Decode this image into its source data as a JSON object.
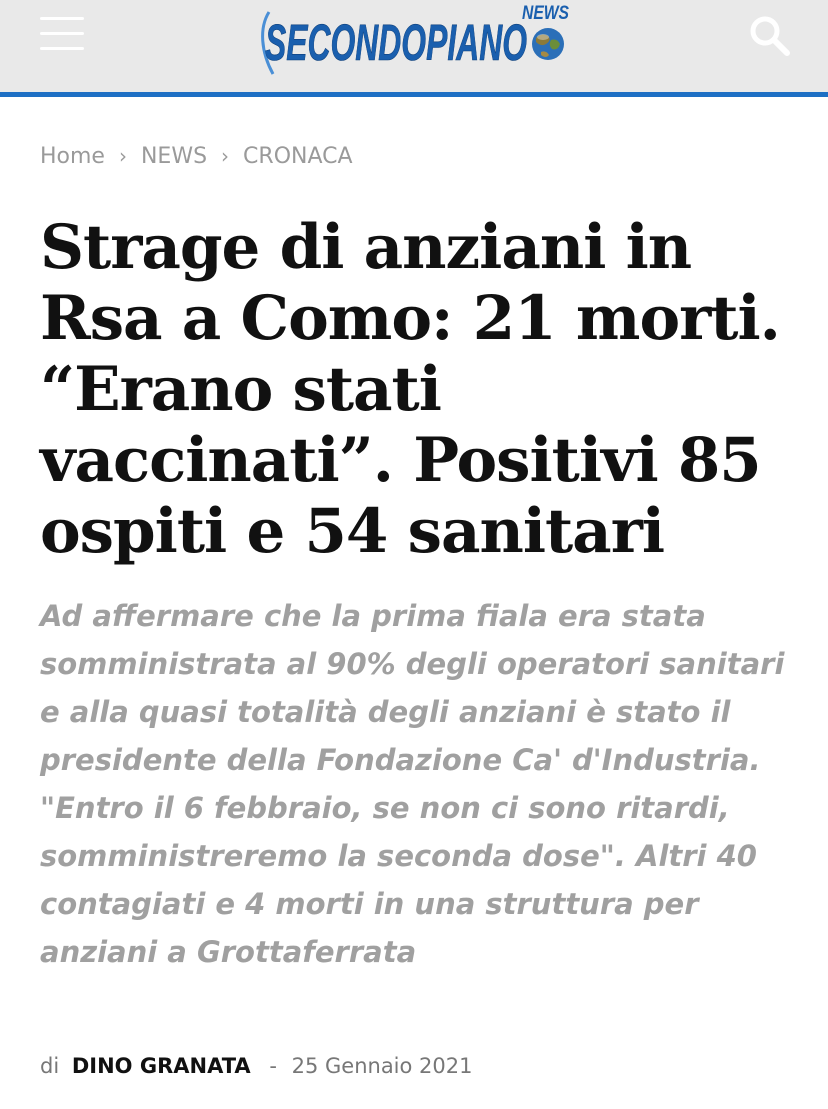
{
  "header": {
    "logo_text": "SECONDOPIANO",
    "logo_suffix": "NEWS",
    "colors": {
      "bar": "#e9e9e9",
      "accent": "#1e6fc4",
      "logo_blue": "#1a5fae"
    },
    "menu_icon": "hamburger-menu-icon",
    "search_icon": "search-icon"
  },
  "breadcrumb": {
    "items": [
      "Home",
      "NEWS",
      "CRONACA"
    ],
    "separator": "›"
  },
  "article": {
    "title": "Strage di anziani in Rsa a Como: 21 morti. “Erano stati vaccinati”. Positivi 85 ospiti e 54 sanitari",
    "subtitle": "Ad affermare che la prima fiala era stata somministrata al 90% degli operatori sanitari e alla quasi totalità degli anziani è stato il presidente della Fondazione Ca' d'Industria. \"Entro il 6 febbraio, se non ci sono ritardi, somministreremo la seconda dose\". Altri 40 contagiati e 4 morti in una struttura per anziani a Grottaferrata",
    "byline": {
      "prefix": "di",
      "author": "DINO GRANATA",
      "dash": "-",
      "date": "25 Gennaio 2021"
    }
  }
}
